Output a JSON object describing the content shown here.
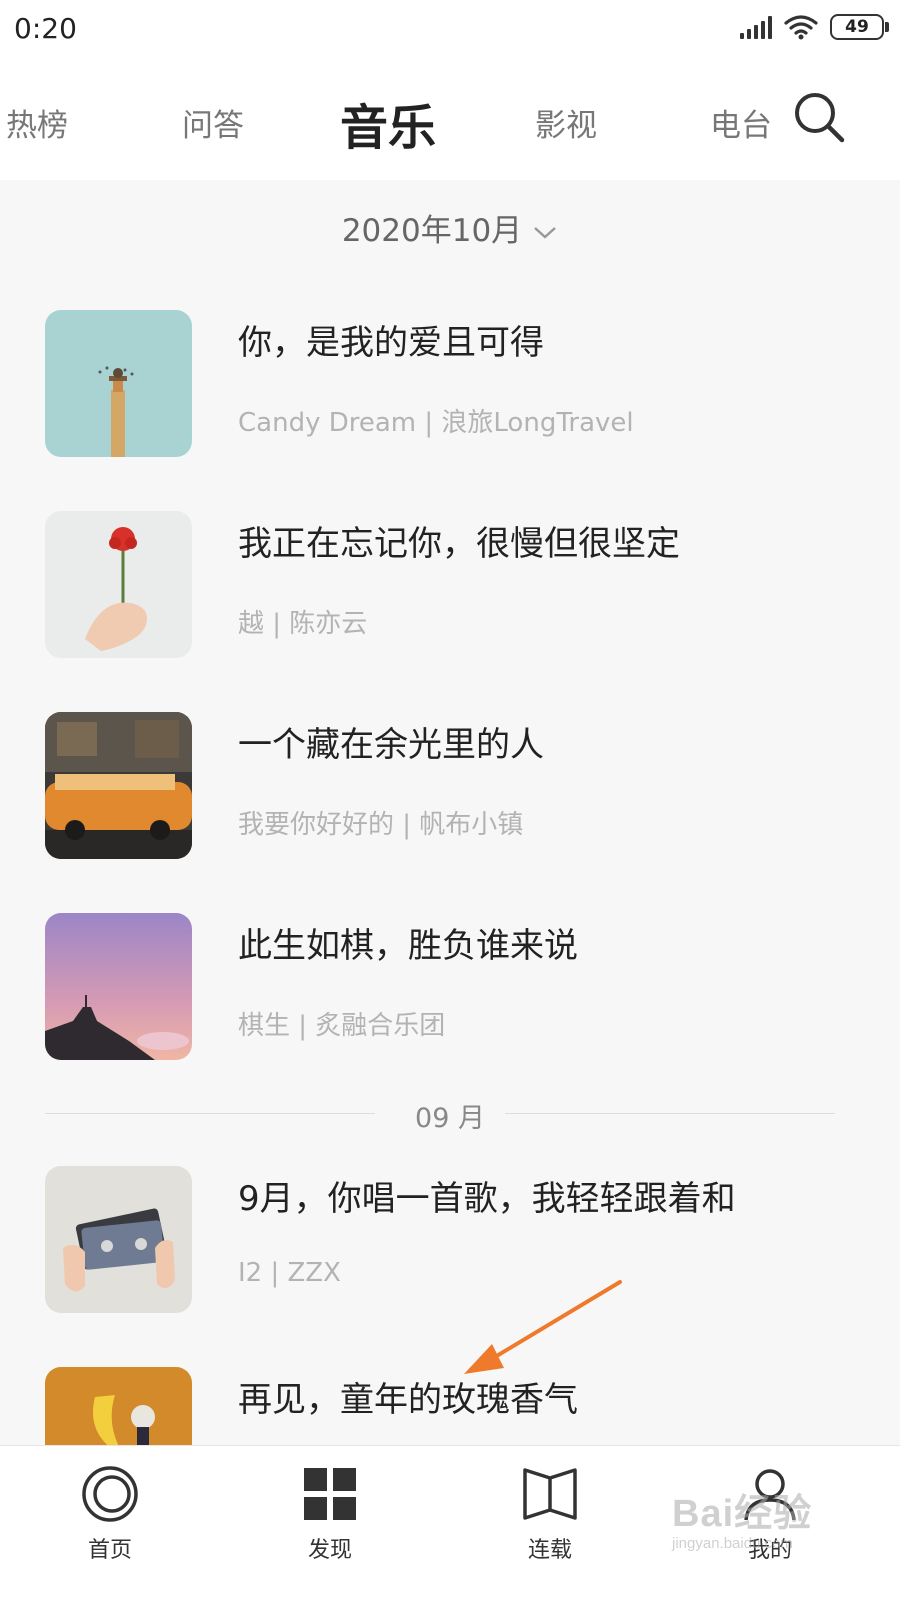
{
  "status_bar": {
    "time": "0:20",
    "battery": "49"
  },
  "tabs": [
    {
      "label": "热榜"
    },
    {
      "label": "问答"
    },
    {
      "label": "音乐",
      "active": true
    },
    {
      "label": "影视"
    },
    {
      "label": "电台"
    }
  ],
  "month_selector": {
    "label": "2020年10月"
  },
  "items": [
    {
      "title": "你，是我的爱且可得",
      "subtitle": "Candy Dream | 浪旅LongTravel"
    },
    {
      "title": "我正在忘记你，很慢但很坚定",
      "subtitle": "越 | 陈亦云"
    },
    {
      "title": "一个藏在余光里的人",
      "subtitle": "我要你好好的 | 帆布小镇"
    },
    {
      "title": "此生如棋，胜负谁来说",
      "subtitle": "棋生 | 炙融合乐团"
    },
    {
      "title": "9月，你唱一首歌，我轻轻跟着和",
      "subtitle": "I2 | ZZX"
    },
    {
      "title": "再见，童年的玫瑰香气",
      "subtitle": ""
    }
  ],
  "divider": {
    "label": "09 月"
  },
  "bottom_nav": [
    {
      "label": "首页",
      "icon": "home-ring-icon"
    },
    {
      "label": "发现",
      "icon": "grid-icon"
    },
    {
      "label": "连载",
      "icon": "book-icon"
    },
    {
      "label": "我的",
      "icon": "user-icon"
    }
  ],
  "watermark": {
    "main": "Bai经验",
    "sub": "jingyan.baidu.com"
  },
  "colors": {
    "accent_arrow": "#f07a2c",
    "subtitle_gray": "#b3b3b3"
  }
}
